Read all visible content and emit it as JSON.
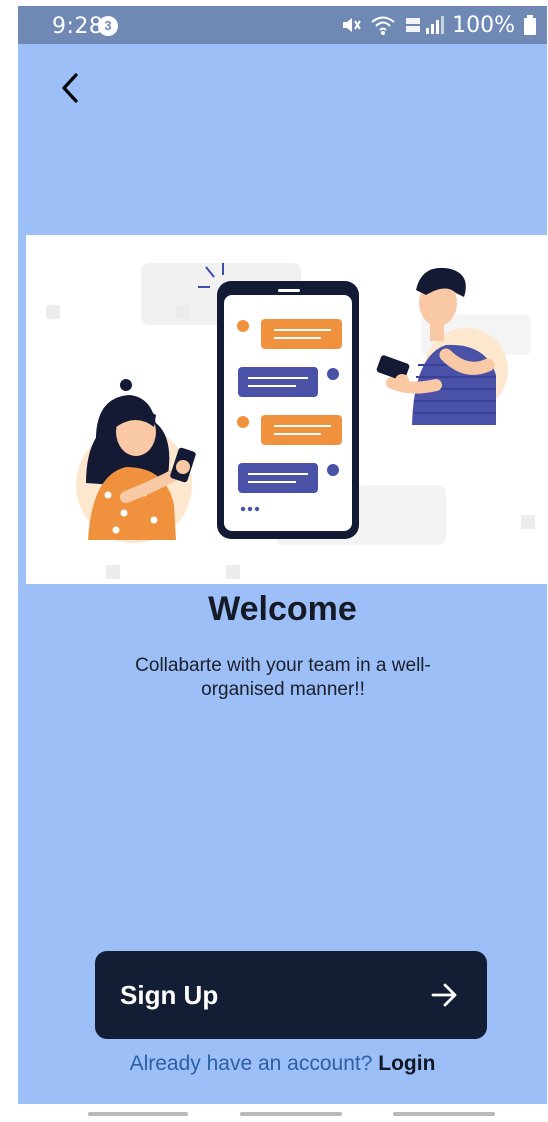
{
  "status_bar": {
    "time": "9:28",
    "notification_count": "3",
    "battery": "100%"
  },
  "welcome": {
    "title": "Welcome",
    "subtitle": "Collabarte with your team in a well-organised manner!!"
  },
  "signup": {
    "label": "Sign Up"
  },
  "login": {
    "prompt": "Already have an account?",
    "link": "Login"
  },
  "colors": {
    "background": "#9dbff7",
    "status_bar": "#6f89b4",
    "button": "#131d33",
    "accent_orange": "#f0913d",
    "accent_blue": "#4a52a8"
  }
}
